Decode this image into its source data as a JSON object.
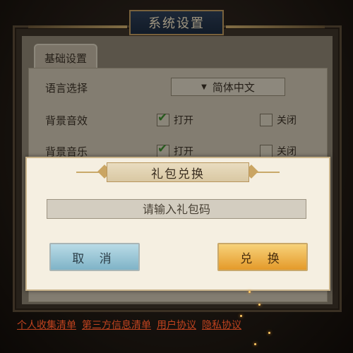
{
  "window": {
    "title": "系统设置"
  },
  "tabs": [
    {
      "label": "基础设置"
    }
  ],
  "settings": {
    "language": {
      "label": "语言选择",
      "value": "简体中文"
    },
    "sound_effects": {
      "label": "背景音效",
      "on_label": "打开",
      "off_label": "关闭",
      "state": "on"
    },
    "music": {
      "label": "背景音乐",
      "on_label": "打开",
      "off_label": "关闭",
      "state": "on"
    }
  },
  "dialog": {
    "title": "礼包兑换",
    "input": {
      "placeholder": "请输入礼包码",
      "value": ""
    },
    "cancel_label": "取 消",
    "confirm_label": "兑 换"
  },
  "footer_links": [
    {
      "label": "个人收集清单"
    },
    {
      "label": "第三方信息清单"
    },
    {
      "label": "用户协议"
    },
    {
      "label": "隐私协议"
    }
  ],
  "colors": {
    "cancel_button": "#7fb3c7",
    "confirm_button": "#e49a2a",
    "link": "#c0431f",
    "title_box": "#2c3e56"
  }
}
